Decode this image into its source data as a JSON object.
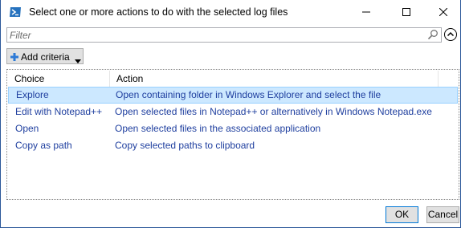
{
  "window": {
    "title": "Select one or more actions to do with the selected log files",
    "icon": "powershell-icon",
    "controls": [
      "minimize-icon",
      "maximize-icon",
      "close-icon"
    ]
  },
  "filter": {
    "placeholder": "Filter",
    "value": ""
  },
  "toolbar": {
    "add_criteria_label": "Add criteria"
  },
  "list": {
    "columns": [
      "Choice",
      "Action"
    ],
    "rows": [
      {
        "choice": "Explore",
        "action": "Open containing folder in Windows Explorer and select the file",
        "selected": true
      },
      {
        "choice": "Edit with Notepad++",
        "action": "Open selected files in Notepad++ or alternatively in Windows Notepad.exe",
        "selected": false
      },
      {
        "choice": "Open",
        "action": "Open selected files in the associated application",
        "selected": false
      },
      {
        "choice": "Copy as path",
        "action": "Copy selected paths to clipboard",
        "selected": false
      }
    ]
  },
  "buttons": {
    "ok_label": "OK",
    "cancel_label": "Cancel"
  },
  "colors": {
    "selection_bg": "#cce8ff",
    "row_text": "#1f3f9f",
    "accent": "#0078d7"
  }
}
